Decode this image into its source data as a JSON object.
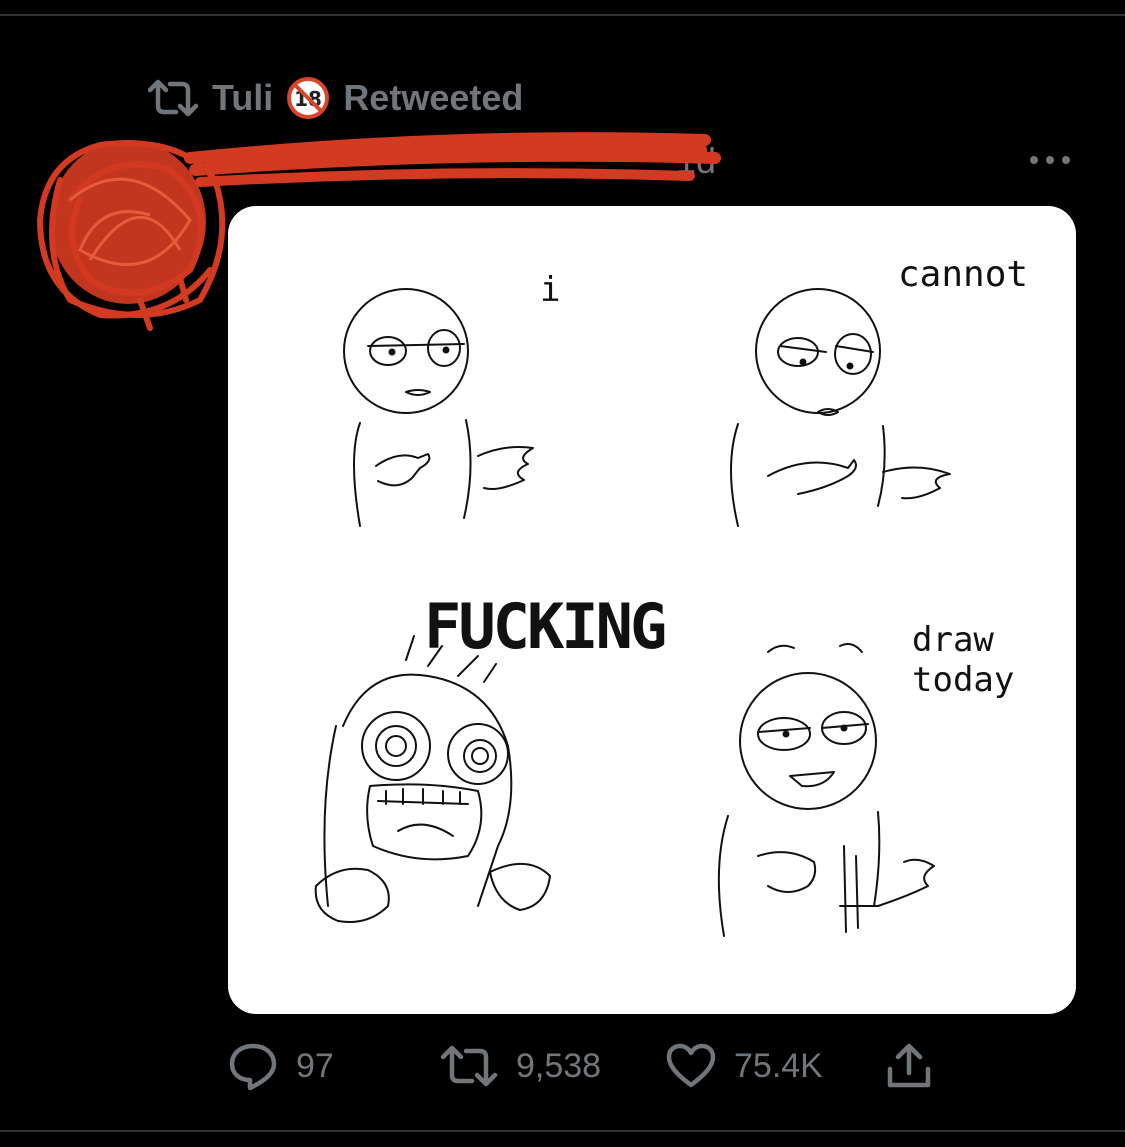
{
  "retweet": {
    "name": "Tuli",
    "label": "Retweeted",
    "icon": "retweet-icon",
    "badge": "no-under-18-icon"
  },
  "tweet": {
    "time": "1d",
    "more_icon": "more-horizontal-icon",
    "media_alt": "Four-panel doodle comic",
    "panels": [
      {
        "text": "i"
      },
      {
        "text": "cannot"
      },
      {
        "text": "FUCKING"
      },
      {
        "text": "draw today"
      }
    ]
  },
  "actions": {
    "replies": "97",
    "retweets": "9,538",
    "likes": "75.4K",
    "reply_icon": "reply-icon",
    "retweet_icon": "retweet-icon",
    "like_icon": "heart-icon",
    "share_icon": "share-icon"
  },
  "colors": {
    "background": "#000000",
    "muted": "#71767b",
    "redaction": "#d23a22"
  }
}
